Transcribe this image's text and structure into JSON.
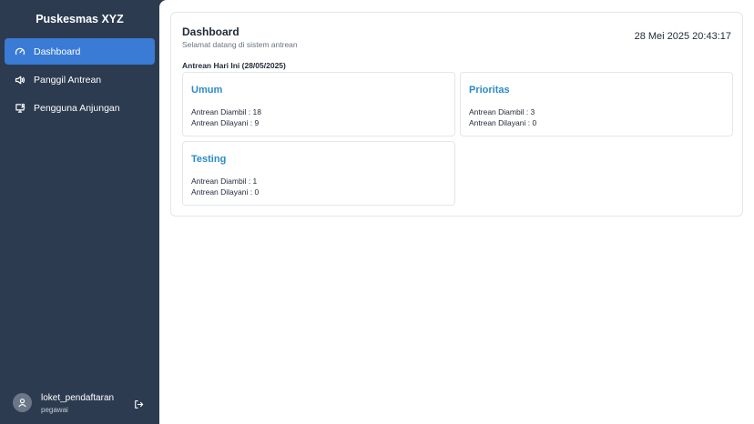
{
  "sidebar": {
    "brand": "Puskesmas XYZ",
    "items": [
      {
        "label": "Dashboard",
        "icon": "gauge-icon",
        "active": true
      },
      {
        "label": "Panggil Antrean",
        "icon": "speaker-icon",
        "active": false
      },
      {
        "label": "Pengguna Anjungan",
        "icon": "monitor-user-icon",
        "active": false
      }
    ],
    "user": {
      "name": "loket_pendaftaran",
      "role": "pegawai"
    }
  },
  "header": {
    "title": "Dashboard",
    "subtitle": "Selamat datang di sistem antrean",
    "datetime": "28 Mei 2025 20:43:17"
  },
  "section": {
    "label": "Antrean Hari Ini (28/05/2025)"
  },
  "cards": [
    {
      "title": "Umum",
      "diambil": "Antrean Diambil : 18",
      "dilayani": "Antrean Dilayani : 9"
    },
    {
      "title": "Prioritas",
      "diambil": "Antrean Diambil : 3",
      "dilayani": "Antrean Dilayani : 0"
    },
    {
      "title": "Testing",
      "diambil": "Antrean Diambil : 1",
      "dilayani": "Antrean Dilayani : 0"
    }
  ],
  "colors": {
    "sidebar": "#2d3b50",
    "active": "#3a7bd5",
    "accent": "#2a8bc9"
  }
}
